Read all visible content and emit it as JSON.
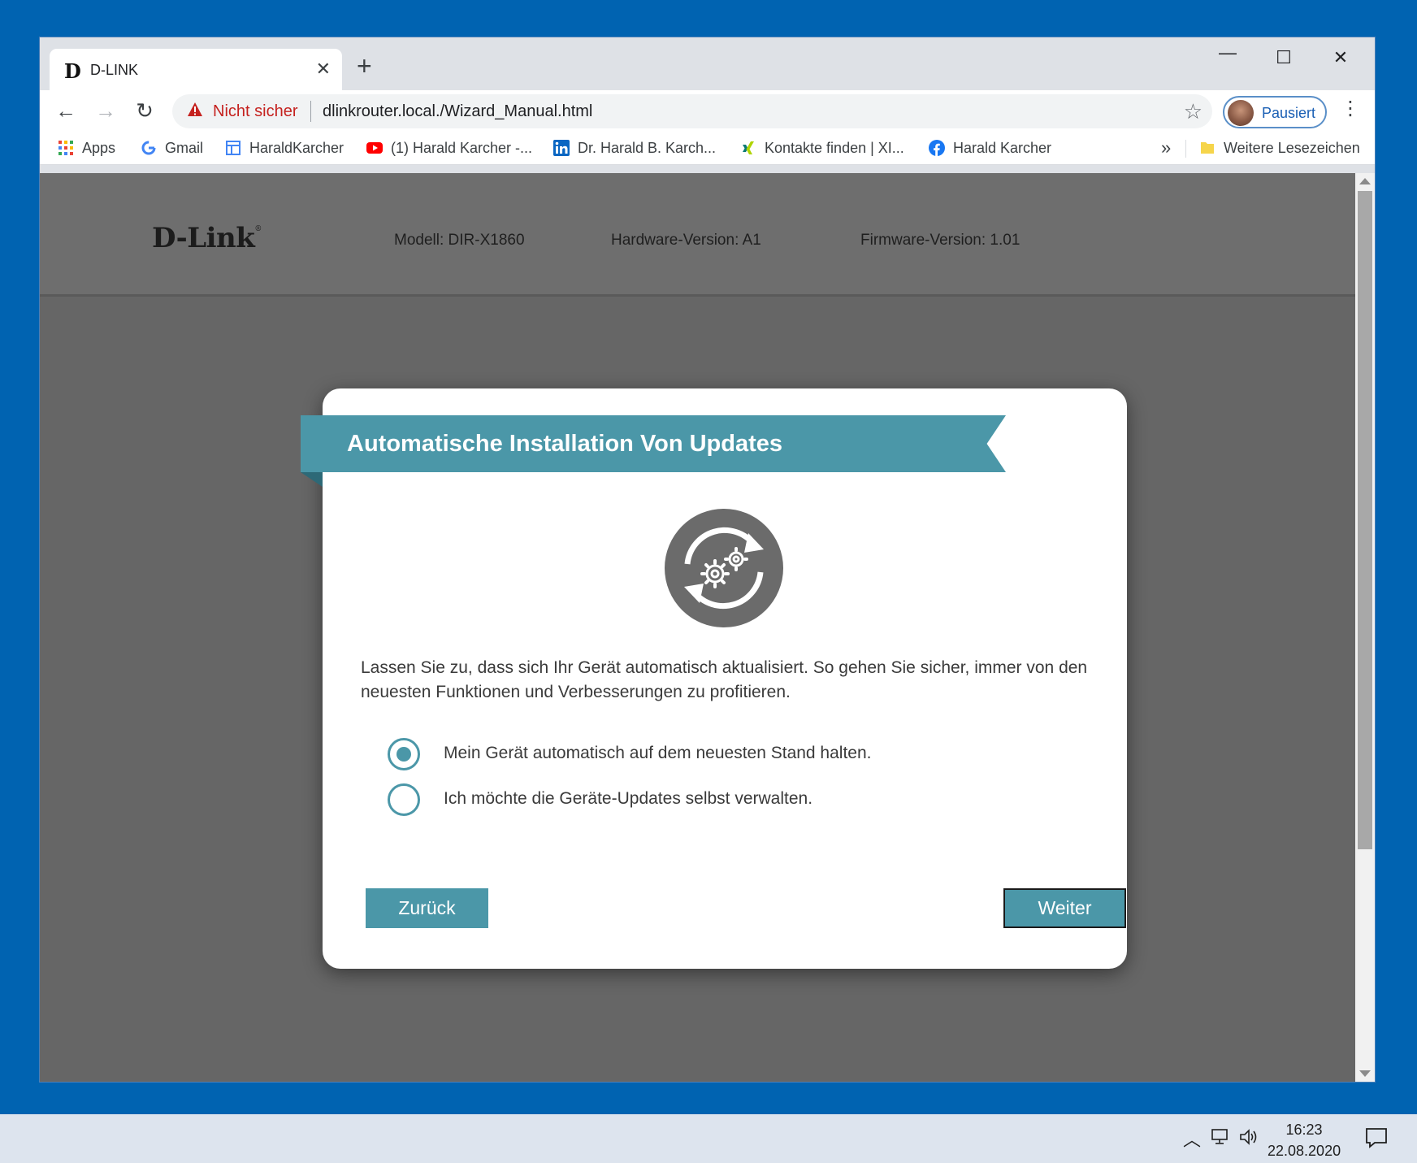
{
  "browser": {
    "tab_title": "D-LINK",
    "tab_favicon": "D",
    "tab_close": "✕",
    "new_tab": "+",
    "window_controls": {
      "minimize": "—",
      "maximize": "☐",
      "close": "✕"
    },
    "nav": {
      "back": "←",
      "forward": "→",
      "reload": "↻"
    },
    "security_label": "Nicht sicher",
    "url_host": "dlinkrouter.local./Wizard_Manual.html",
    "star": "☆",
    "profile_label": "Pausiert",
    "menu": "⋮",
    "bookmarks": [
      {
        "label": "Apps",
        "icon": "apps-grid-icon"
      },
      {
        "label": "Gmail",
        "icon": "google-icon"
      },
      {
        "label": "HaraldKarcher",
        "icon": "site-layout-icon"
      },
      {
        "label": "(1) Harald Karcher -...",
        "icon": "youtube-icon"
      },
      {
        "label": "Dr. Harald B. Karch...",
        "icon": "linkedin-icon"
      },
      {
        "label": "Kontakte finden | XI...",
        "icon": "xing-icon"
      },
      {
        "label": "Harald Karcher",
        "icon": "facebook-icon"
      }
    ],
    "bookmarks_more": "»",
    "other_bookmarks": "Weitere Lesezeichen"
  },
  "router_header": {
    "logo": "D-Link",
    "logo_mark": "®",
    "model": "Modell: DIR-X1860",
    "hardware": "Hardware-Version: A1",
    "firmware": "Firmware-Version: 1.01"
  },
  "wizard": {
    "title": "Automatische Installation Von Updates",
    "icon": "auto-update-gears-icon",
    "description": "Lassen Sie zu, dass sich Ihr Gerät automatisch aktualisiert. So gehen Sie sicher, immer von den neuesten Funktionen und Verbesserungen zu profitieren.",
    "options": [
      {
        "label": "Mein Gerät automatisch auf dem neuesten Stand halten.",
        "selected": true
      },
      {
        "label": "Ich möchte die Geräte-Updates selbst verwalten.",
        "selected": false
      }
    ],
    "back_button": "Zurück",
    "next_button": "Weiter"
  },
  "taskbar": {
    "chevron": "︿",
    "time": "16:23",
    "date": "22.08.2020"
  },
  "colors": {
    "desktop": "#0063b1",
    "accent": "#4b97a8",
    "overlay": "#666666",
    "warning": "#c5221f"
  }
}
